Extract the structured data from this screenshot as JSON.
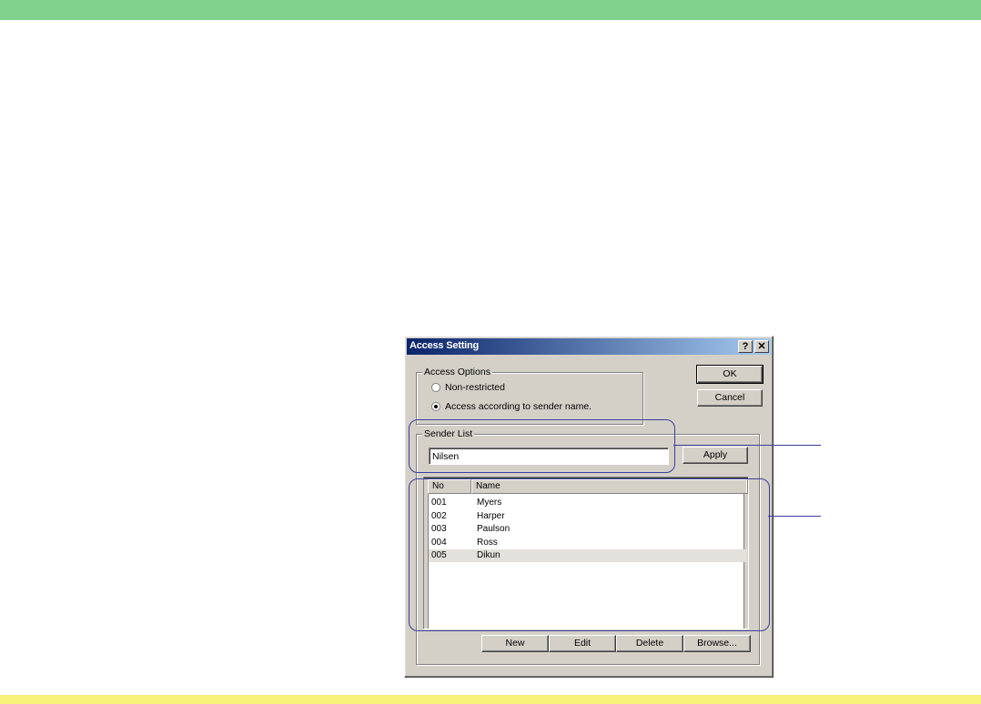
{
  "dialog": {
    "title": "Access Setting",
    "help_label": "?",
    "close_label": "✕"
  },
  "access_options": {
    "legend": "Access Options",
    "options": [
      {
        "label": "Non-restricted",
        "checked": false
      },
      {
        "label": "Access according to sender name.",
        "checked": true
      }
    ]
  },
  "buttons": {
    "ok": "OK",
    "cancel": "Cancel",
    "apply": "Apply",
    "new": "New",
    "edit": "Edit",
    "delete": "Delete",
    "browse": "Browse..."
  },
  "sender_list": {
    "legend": "Sender List",
    "input_value": "Nilsen",
    "columns": [
      "No",
      "Name"
    ],
    "rows": [
      {
        "no": "001",
        "name": "Myers"
      },
      {
        "no": "002",
        "name": "Harper"
      },
      {
        "no": "003",
        "name": "Paulson"
      },
      {
        "no": "004",
        "name": "Ross"
      },
      {
        "no": "005",
        "name": "Dikun"
      }
    ],
    "selected_index": 4
  },
  "colors": {
    "top_band": "#7fd18c",
    "bottom_band": "#f7f27a",
    "callout": "#3a3f9a",
    "titlebar_start": "#0a246a",
    "titlebar_end": "#a6caf0"
  }
}
